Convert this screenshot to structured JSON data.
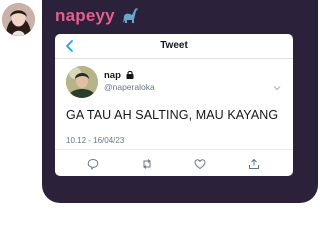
{
  "chat": {
    "sender_name": "napeyy",
    "sender_emoji": "sauropod-emoji"
  },
  "tweet_card": {
    "header_title": "Tweet",
    "user": {
      "display_name": "nap",
      "handle": "@naperaloka",
      "protected_icon": "lock-icon"
    },
    "text": "GA TAU AH SALTING, MAU KAYANG",
    "timestamp": "10.12 - 16/04/23",
    "actions": [
      "reply-icon",
      "retweet-icon",
      "like-icon",
      "share-icon"
    ]
  },
  "colors": {
    "bubble_background": "#2c213b",
    "sender_name": "#e25f8f",
    "link_blue": "#1da1f2",
    "secondary_text": "#657786"
  }
}
